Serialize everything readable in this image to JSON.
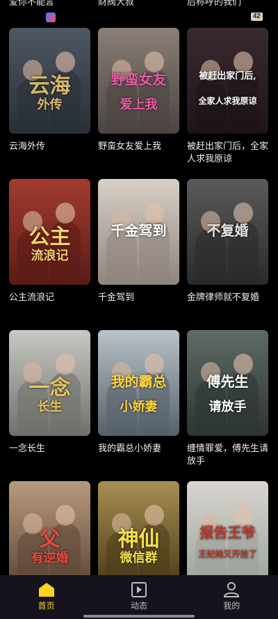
{
  "top_row": {
    "titles": [
      "爱你不能言",
      "财阀大叔",
      "后称呼的我们"
    ],
    "count_badge": "42"
  },
  "dramas": [
    {
      "title": "云海外传",
      "poster_text": "云海",
      "poster_sub": "外传",
      "colors": [
        "#4d5763",
        "#2a2f37",
        "#d6b86a"
      ]
    },
    {
      "title": "野蛮女友爱上我",
      "poster_text": "野蛮女友",
      "poster_sub": "爱上我",
      "colors": [
        "#8a7f78",
        "#4b4440",
        "#e85aa8"
      ]
    },
    {
      "title": "被赶出家门后，全家人求我原谅",
      "poster_text": "被赶出家门后,",
      "poster_sub": "全家人求我原谅",
      "colors": [
        "#3a2a30",
        "#1e1418",
        "#ffffff"
      ]
    },
    {
      "title": "公主流浪记",
      "poster_text": "公主",
      "poster_sub": "流浪记",
      "colors": [
        "#a33b2f",
        "#5a1c15",
        "#f2d16b"
      ]
    },
    {
      "title": "千金驾到",
      "poster_text": "千金驾到",
      "poster_sub": "",
      "colors": [
        "#d8cfc6",
        "#8f857d",
        "#ffffff"
      ]
    },
    {
      "title": "金牌律师就不复婚",
      "poster_text": "不复婚",
      "poster_sub": "",
      "colors": [
        "#5a5a5a",
        "#2a2a2a",
        "#e6e6e6"
      ]
    },
    {
      "title": "一念长生",
      "poster_text": "一念",
      "poster_sub": "长生",
      "colors": [
        "#c9c9c4",
        "#6e706a",
        "#e8c45a"
      ]
    },
    {
      "title": "我的霸总小娇妻",
      "poster_text": "我的霸总",
      "poster_sub": "小娇妻",
      "colors": [
        "#b9c3c9",
        "#55606a",
        "#ffd43b"
      ]
    },
    {
      "title": "缠情罪爱，傅先生请放手",
      "poster_text": "傅先生",
      "poster_sub": "请放手",
      "colors": [
        "#5f6b66",
        "#2c3431",
        "#ffffff"
      ]
    },
    {
      "title": "",
      "poster_text": "父",
      "poster_sub": "有逆婚",
      "colors": [
        "#b89a7e",
        "#5d4636",
        "#e84b3c"
      ]
    },
    {
      "title": "",
      "poster_text": "神仙",
      "poster_sub": "微信群",
      "colors": [
        "#a78f52",
        "#4a3a18",
        "#f4e04d"
      ]
    },
    {
      "title": "",
      "poster_text": "报告王爷",
      "poster_sub": "王妃她又开挂了",
      "colors": [
        "#d9d5d0",
        "#9aa39b",
        "#c0392b"
      ]
    }
  ],
  "tabbar": {
    "tabs": [
      {
        "label": "首页",
        "icon": "home-icon",
        "active": true
      },
      {
        "label": "动态",
        "icon": "play-square-icon",
        "active": false
      },
      {
        "label": "我的",
        "icon": "person-icon",
        "active": false
      }
    ],
    "active_color": "#ffd21f"
  }
}
